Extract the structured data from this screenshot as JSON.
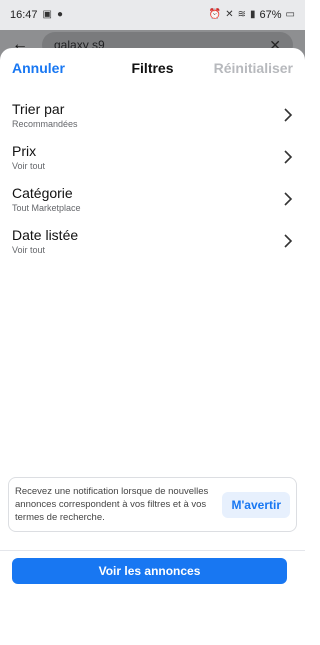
{
  "status_bar": {
    "time": "16:47",
    "battery": "67%"
  },
  "search": {
    "query": "galaxy s9"
  },
  "sheet": {
    "cancel_label": "Annuler",
    "title": "Filtres",
    "reset_label": "Réinitialiser"
  },
  "filters": [
    {
      "label": "Trier par",
      "value": "Recommandées"
    },
    {
      "label": "Prix",
      "value": "Voir tout"
    },
    {
      "label": "Catégorie",
      "value": "Tout Marketplace"
    },
    {
      "label": "Date listée",
      "value": "Voir tout"
    }
  ],
  "notify": {
    "text": "Recevez une notification lorsque de nouvelles annonces correspondent à vos filtres et à vos termes de recherche.",
    "button_label": "M'avertir"
  },
  "footer": {
    "primary_label": "Voir les annonces"
  },
  "colors": {
    "accent": "#1877f2",
    "disabled": "#b7b9bd"
  }
}
